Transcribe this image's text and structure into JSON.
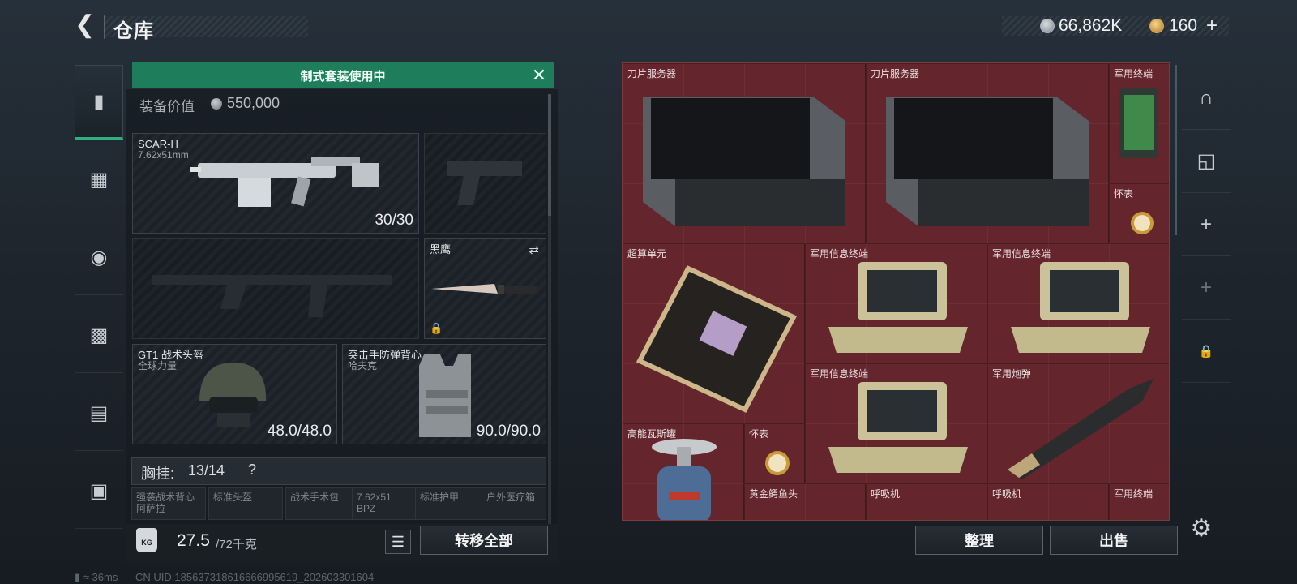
{
  "header": {
    "title": "仓库",
    "currency": "66,862K",
    "tickets": "160",
    "plus": "+"
  },
  "rail": {
    "items": [
      {
        "name": "weapon",
        "icon": "pistol-icon"
      },
      {
        "name": "armor",
        "icon": "vest-icon"
      },
      {
        "name": "helmet",
        "icon": "helmet-icon"
      },
      {
        "name": "backpack",
        "icon": "backpack-icon"
      },
      {
        "name": "container",
        "icon": "case-icon"
      },
      {
        "name": "suitcase",
        "icon": "briefcase-icon"
      }
    ]
  },
  "loadout": {
    "banner": "制式套装使用中",
    "value_label": "装备价值",
    "value": "550,000",
    "primary": {
      "name": "SCAR-H",
      "caliber": "7.62x51mm",
      "ammo": "30/30"
    },
    "melee": {
      "name": "黑鹰"
    },
    "helmet": {
      "name": "GT1 战术头盔",
      "maker": "全球力量",
      "durability": "48.0/48.0"
    },
    "armor": {
      "name": "突击手防弹背心",
      "maker": "哈夫克",
      "durability": "90.0/90.0"
    },
    "chest": {
      "label": "胸挂:",
      "count": "13/14",
      "help": "?"
    },
    "mini_slots": [
      "强袭战术背心\n阿萨拉",
      "标准头盔",
      "战术手术包",
      "7.62x51\nBPZ",
      "标准护甲",
      "户外医疗箱"
    ],
    "weight": "27.5",
    "weight_max": "/72千克",
    "kg": "KG",
    "transfer_all": "转移全部"
  },
  "storage": {
    "items": [
      {
        "label": "刀片服务器"
      },
      {
        "label": "刀片服务器"
      },
      {
        "label": "军用终端"
      },
      {
        "label": "怀表"
      },
      {
        "label": "超算单元"
      },
      {
        "label": "军用信息终端"
      },
      {
        "label": "军用信息终端"
      },
      {
        "label": "军用信息终端"
      },
      {
        "label": "军用炮弹"
      },
      {
        "label": "高能瓦斯罐"
      },
      {
        "label": "怀表"
      },
      {
        "label": "黄金鳄鱼头"
      },
      {
        "label": "呼吸机"
      },
      {
        "label": "呼吸机"
      },
      {
        "label": "军用终端"
      }
    ],
    "sort": "整理",
    "sell": "出售"
  },
  "status": {
    "ping": "36ms",
    "uid": "CN UID:1856373186166669956​19_202603301604"
  },
  "colors": {
    "accent": "#1e7d5a",
    "storage_bg": "#5a2328"
  }
}
